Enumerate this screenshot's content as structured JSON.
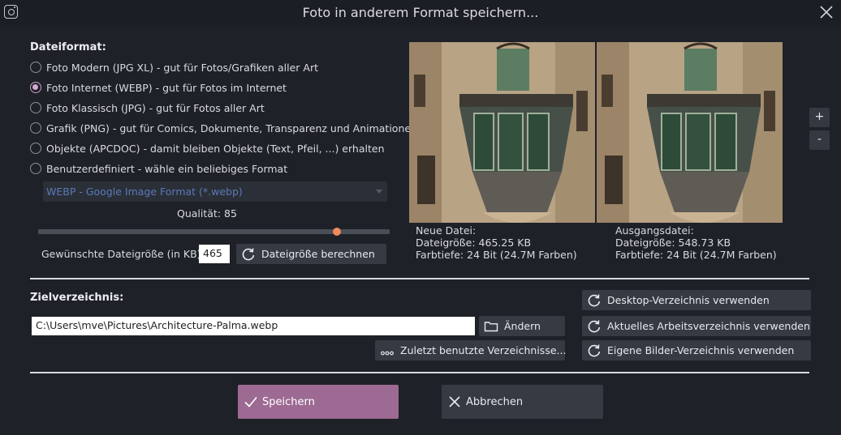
{
  "window": {
    "title": "Foto in anderem Format speichern..."
  },
  "format": {
    "heading": "Dateiformat:",
    "options": [
      {
        "label": "Foto Modern (JPG XL) - gut für Fotos/Grafiken aller Art",
        "selected": false
      },
      {
        "label": "Foto Internet (WEBP) - gut für Fotos im Internet",
        "selected": true
      },
      {
        "label": "Foto Klassisch (JPG) - gut für Fotos aller Art",
        "selected": false
      },
      {
        "label": "Grafik (PNG) - gut für Comics, Dokumente, Transparenz und Animationen",
        "selected": false
      },
      {
        "label": "Objekte (APCDOC) - damit bleiben Objekte (Text, Pfeil, ...) erhalten",
        "selected": false
      },
      {
        "label": "Benutzerdefiniert - wähle ein beliebiges Format",
        "selected": false
      }
    ],
    "custom_select_value": "WEBP - Google Image Format (*.webp)",
    "quality_label": "Qualität:",
    "quality_value": "85",
    "quality_fraction": 0.85,
    "target_size_label": "Gewünschte Dateigröße (in KB):",
    "target_size_value": "465",
    "calc_button": "Dateigröße berechnen"
  },
  "preview": {
    "zoom_in": "+",
    "zoom_out": "-",
    "new_file": {
      "heading": "Neue Datei:",
      "size": "Dateigröße: 465.25 KB",
      "depth": "Farbtiefe: 24 Bit (24.7M Farben)"
    },
    "source_file": {
      "heading": "Ausgangsdatei:",
      "size": "Dateigröße: 548.73 KB",
      "depth": "Farbtiefe: 24 Bit (24.7M Farben)"
    }
  },
  "destination": {
    "heading": "Zielverzeichnis:",
    "path": "C:\\Users\\mve\\Pictures\\Architecture-Palma.webp",
    "change_button": "Ändern",
    "recent_button": "Zuletzt benutzte Verzeichnisse...",
    "desktop_button": "Desktop-Verzeichnis verwenden",
    "workdir_button": "Aktuelles Arbeitsverzeichnis verwenden",
    "pictures_button": "Eigene Bilder-Verzeichnis verwenden"
  },
  "actions": {
    "save": "Speichern",
    "cancel": "Abbrechen"
  },
  "colors": {
    "accent": "#9d6a93",
    "slider_thumb": "#f08a5a",
    "background": "#1e2128"
  }
}
